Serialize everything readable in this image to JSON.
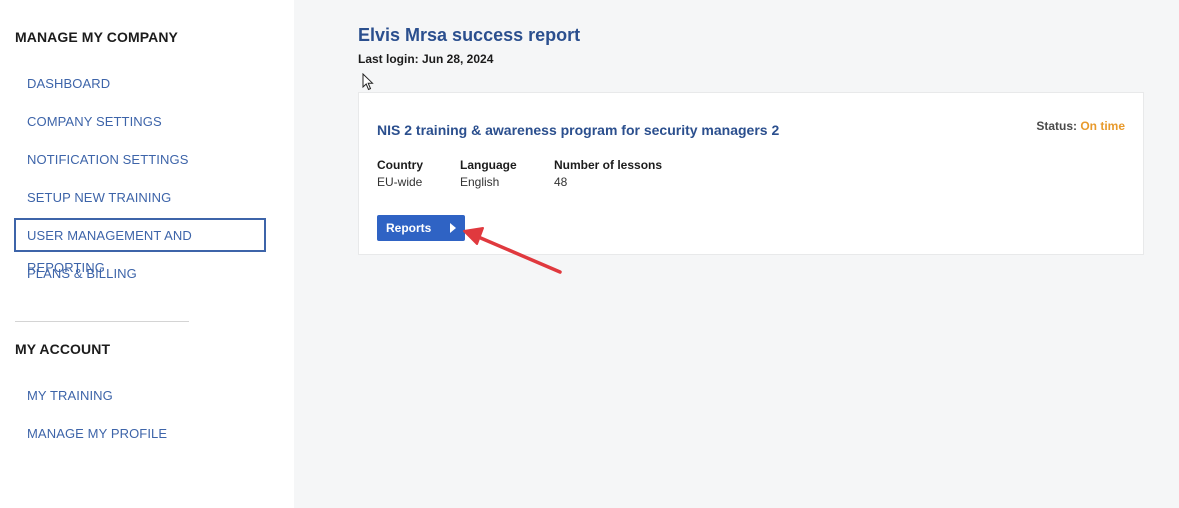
{
  "sidebar": {
    "manage_heading": "MANAGE MY COMPANY",
    "manage_items": [
      {
        "label": "DASHBOARD"
      },
      {
        "label": "COMPANY SETTINGS"
      },
      {
        "label": "NOTIFICATION SETTINGS"
      },
      {
        "label": "SETUP NEW TRAINING"
      },
      {
        "label": "USER MANAGEMENT AND REPORTING"
      },
      {
        "label": "PLANS & BILLING"
      }
    ],
    "account_heading": "MY ACCOUNT",
    "account_items": [
      {
        "label": "MY TRAINING"
      },
      {
        "label": "MANAGE MY PROFILE"
      }
    ]
  },
  "report": {
    "title": "Elvis Mrsa success report",
    "last_login": "Last login: Jun 28, 2024"
  },
  "card": {
    "course_title": "NIS 2 training & awareness program for security managers 2",
    "status_label": "Status:",
    "status_value": "On time",
    "meta": [
      {
        "label": "Country",
        "value": "EU-wide"
      },
      {
        "label": "Language",
        "value": "English"
      },
      {
        "label": "Number of lessons",
        "value": "48"
      }
    ],
    "reports_button": "Reports"
  },
  "colors": {
    "link": "#3d64a9",
    "title": "#2b4f8e",
    "button": "#2f63c4",
    "status_on_time": "#e89a2c",
    "annotation_arrow": "#e0393e"
  },
  "icons": {
    "reports_button_icon": "caret-right-icon",
    "cursor": "mouse-pointer-icon",
    "annotation": "red-arrow-annotation"
  }
}
